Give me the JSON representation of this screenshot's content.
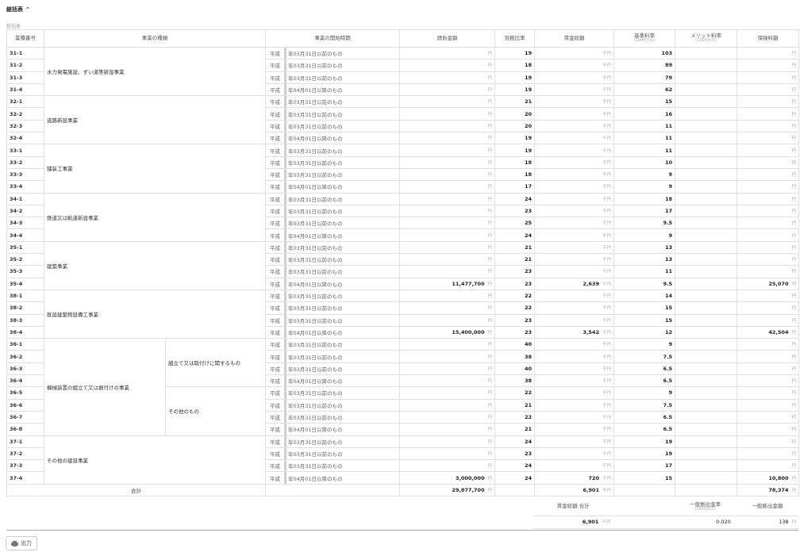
{
  "section": {
    "title": "総括表"
  },
  "table_caption": "総括表",
  "headers": {
    "code": "業種番号",
    "business_type": "事業の種類",
    "period": "事業の開始時期",
    "contract_amount": "請負金額",
    "labor_ratio": "労務比率",
    "wage_total": "賃金総額",
    "basic_rate": "基準料率",
    "basic_rate_sub": "(1000分の)",
    "merit_rate": "メリット料率",
    "merit_rate_sub": "(1000分の)",
    "insurance_fee": "保険料額"
  },
  "units": {
    "yen": "円",
    "thousand_yen": "千円"
  },
  "era_prefix": "平成",
  "period_text": {
    "before": "年03月31日以前のもの",
    "after": "年04月01日以降のもの"
  },
  "groups": [
    {
      "name": "水力発電施設、ずい道等新設事業",
      "rows": [
        {
          "code": "31-1",
          "period": "before",
          "ratio": "19",
          "rate": "103"
        },
        {
          "code": "31-2",
          "period": "before",
          "ratio": "18",
          "rate": "89"
        },
        {
          "code": "31-3",
          "period": "before",
          "ratio": "19",
          "rate": "79"
        },
        {
          "code": "31-4",
          "period": "after",
          "ratio": "19",
          "rate": "62"
        }
      ]
    },
    {
      "name": "道路新設事業",
      "rows": [
        {
          "code": "32-1",
          "period": "before",
          "ratio": "21",
          "rate": "15"
        },
        {
          "code": "32-2",
          "period": "before",
          "ratio": "20",
          "rate": "16"
        },
        {
          "code": "32-3",
          "period": "before",
          "ratio": "20",
          "rate": "11"
        },
        {
          "code": "32-4",
          "period": "after",
          "ratio": "19",
          "rate": "11"
        }
      ]
    },
    {
      "name": "舗装工事業",
      "rows": [
        {
          "code": "33-1",
          "period": "before",
          "ratio": "19",
          "rate": "11"
        },
        {
          "code": "33-2",
          "period": "before",
          "ratio": "18",
          "rate": "10"
        },
        {
          "code": "33-3",
          "period": "before",
          "ratio": "18",
          "rate": "9"
        },
        {
          "code": "33-4",
          "period": "after",
          "ratio": "17",
          "rate": "9"
        }
      ]
    },
    {
      "name": "鉄道又は軌道新設事業",
      "rows": [
        {
          "code": "34-1",
          "period": "before",
          "ratio": "24",
          "rate": "18"
        },
        {
          "code": "34-2",
          "period": "before",
          "ratio": "23",
          "rate": "17"
        },
        {
          "code": "34-3",
          "period": "before",
          "ratio": "25",
          "rate": "9.5"
        },
        {
          "code": "34-4",
          "period": "after",
          "ratio": "24",
          "rate": "9"
        }
      ]
    },
    {
      "name": "建築事業",
      "rows": [
        {
          "code": "35-1",
          "period": "before",
          "ratio": "21",
          "rate": "13"
        },
        {
          "code": "35-2",
          "period": "before",
          "ratio": "21",
          "rate": "13"
        },
        {
          "code": "35-3",
          "period": "before",
          "ratio": "23",
          "rate": "11"
        },
        {
          "code": "35-4",
          "period": "after",
          "amount": "11,477,700",
          "ratio": "23",
          "wage": "2,639",
          "rate": "9.5",
          "fee": "25,070"
        }
      ]
    },
    {
      "name": "既設建築物設備工事業",
      "rows": [
        {
          "code": "38-1",
          "period": "before",
          "ratio": "22",
          "rate": "14"
        },
        {
          "code": "38-2",
          "period": "before",
          "ratio": "22",
          "rate": "15"
        },
        {
          "code": "38-3",
          "period": "before",
          "ratio": "23",
          "rate": "15"
        },
        {
          "code": "38-4",
          "period": "after",
          "amount": "15,400,000",
          "ratio": "23",
          "wage": "3,542",
          "rate": "12",
          "fee": "42,504"
        }
      ]
    },
    {
      "name": "機械装置の組立て又は据付けの事業",
      "subs": [
        {
          "name": "組立て又は取付けに関するもの",
          "rows": [
            {
              "code": "36-1",
              "period": "before",
              "ratio": "40",
              "rate": "9"
            },
            {
              "code": "36-2",
              "period": "before",
              "ratio": "38",
              "rate": "7.5"
            },
            {
              "code": "36-3",
              "period": "before",
              "ratio": "40",
              "rate": "6.5"
            },
            {
              "code": "36-4",
              "period": "after",
              "ratio": "38",
              "rate": "6.5"
            }
          ]
        },
        {
          "name": "その他のもの",
          "rows": [
            {
              "code": "36-5",
              "period": "before",
              "ratio": "22",
              "rate": "9"
            },
            {
              "code": "36-6",
              "period": "before",
              "ratio": "21",
              "rate": "7.5"
            },
            {
              "code": "36-7",
              "period": "before",
              "ratio": "22",
              "rate": "6.5"
            },
            {
              "code": "36-8",
              "period": "after",
              "ratio": "21",
              "rate": "6.5"
            }
          ]
        }
      ]
    },
    {
      "name": "その他の建設事業",
      "rows": [
        {
          "code": "37-1",
          "period": "before",
          "ratio": "24",
          "rate": "19"
        },
        {
          "code": "37-2",
          "period": "before",
          "ratio": "23",
          "rate": "19"
        },
        {
          "code": "37-3",
          "period": "before",
          "ratio": "24",
          "rate": "17"
        },
        {
          "code": "37-4",
          "period": "after",
          "amount": "3,000,000",
          "ratio": "24",
          "wage": "720",
          "rate": "15",
          "fee": "10,800"
        }
      ]
    }
  ],
  "total": {
    "label": "合計",
    "amount": "29,877,700",
    "wage": "6,901",
    "fee": "78,374"
  },
  "summary": {
    "wage_total_label": "賃金総額 合計",
    "general_rate_label": "一般拠出金率",
    "general_rate_sub": "(1000分の)",
    "general_amount_label": "一般拠出金額",
    "wage_total": "6,901",
    "general_rate": "0.020",
    "general_amount": "138"
  },
  "print_button": {
    "label": "出力"
  }
}
